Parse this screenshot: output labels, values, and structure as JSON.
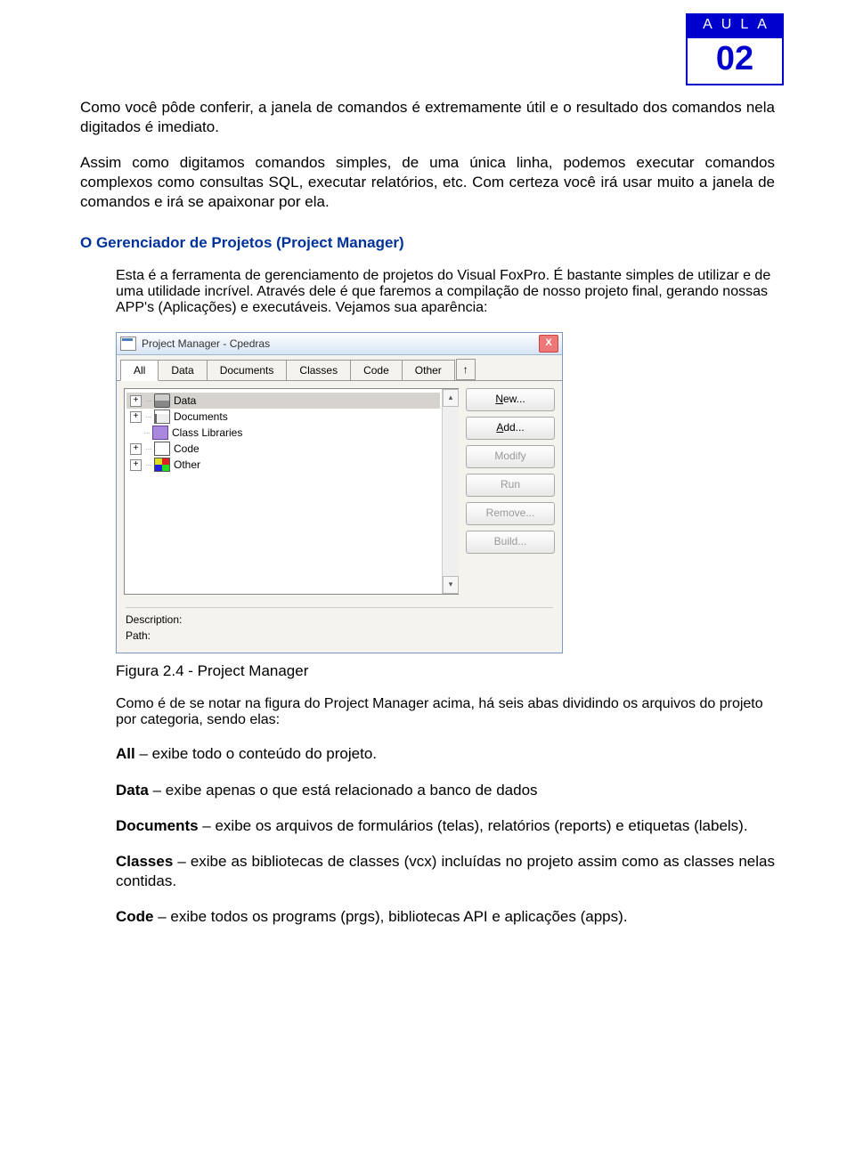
{
  "header": {
    "aula_label": "AULA",
    "aula_number": "02"
  },
  "intro": {
    "p1": "Como você pôde conferir, a janela de comandos é extremamente útil e o resultado dos comandos nela digitados é imediato.",
    "p2": "Assim como digitamos comandos simples, de uma única linha, podemos executar comandos complexos como consultas SQL, executar relatórios, etc. Com certeza você irá usar muito a janela de comandos e irá se apaixonar por ela."
  },
  "section": {
    "title": "O Gerenciador de Projetos (Project Manager)",
    "desc": "Esta é a ferramenta de gerenciamento de projetos do Visual FoxPro. É bastante simples de utilizar e de uma utilidade incrível. Através dele é que faremos a compilação de nosso projeto final, gerando nossas APP's (Aplicações) e executáveis. Vejamos sua aparência:"
  },
  "pm": {
    "title": "Project Manager - Cpedras",
    "close": "X",
    "tabs": [
      "All",
      "Data",
      "Documents",
      "Classes",
      "Code",
      "Other"
    ],
    "collapse": "↑",
    "tree": [
      {
        "toggle": "+",
        "icon": "ic-data",
        "label": "Data",
        "sel": true
      },
      {
        "toggle": "+",
        "icon": "ic-docs",
        "label": "Documents",
        "sel": false
      },
      {
        "toggle": "",
        "icon": "ic-class",
        "label": "Class Libraries",
        "sel": false
      },
      {
        "toggle": "+",
        "icon": "ic-code",
        "label": "Code",
        "sel": false
      },
      {
        "toggle": "+",
        "icon": "ic-other",
        "label": "Other",
        "sel": false
      }
    ],
    "scroll_up": "▴",
    "scroll_down": "▾",
    "buttons": {
      "new": "New...",
      "add": "Add...",
      "modify": "Modify",
      "run": "Run",
      "remove": "Remove...",
      "build": "Build..."
    },
    "info": {
      "description_label": "Description:",
      "path_label": "Path:"
    }
  },
  "caption": "Figura 2.4 - Project Manager",
  "after": {
    "p1": "Como é de se notar na figura do Project Manager acima, há seis abas dividindo os arquivos do projeto por categoria, sendo elas:",
    "defs": {
      "all": {
        "term": "All",
        "text": " – exibe todo o conteúdo do projeto."
      },
      "data": {
        "term": "Data",
        "text": " – exibe apenas o que está relacionado a banco de dados"
      },
      "documents": {
        "term": "Documents",
        "text": " – exibe os arquivos de formulários (telas), relatórios (reports) e etiquetas (labels)."
      },
      "classes": {
        "term": "Classes",
        "text": " – exibe as bibliotecas de classes  (vcx) incluídas no projeto assim como as classes nelas contidas."
      },
      "code": {
        "term": "Code",
        "text": " – exibe todos os programs (prgs), bibliotecas API e aplicações (apps)."
      }
    }
  }
}
